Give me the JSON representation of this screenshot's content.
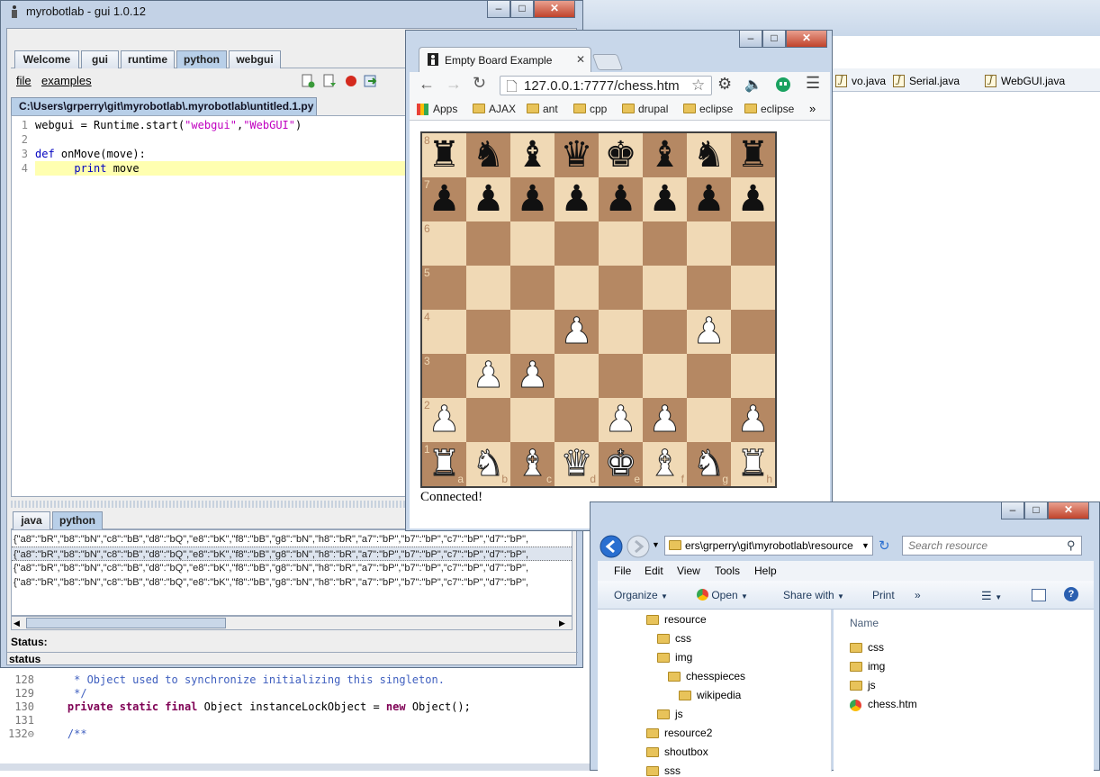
{
  "background": {
    "editor_tabs": [
      {
        "label": "vo.java"
      },
      {
        "label": "Serial.java"
      },
      {
        "label": "WebGUI.java"
      }
    ],
    "code_lines": [
      {
        "num": "128",
        "text": "     * Object used to synchronize initializing this singleton."
      },
      {
        "num": "129",
        "text": "     */"
      },
      {
        "num": "130",
        "kw": "private static final",
        "text": " Object instanceLockObject = ",
        "kw2": "new",
        "text2": " Object();"
      },
      {
        "num": "131",
        "text": ""
      },
      {
        "num": "132⊖",
        "text": "    /**"
      }
    ]
  },
  "mrl": {
    "title": "myrobotlab - gui 1.0.12",
    "tabs": [
      {
        "label": "Welcome"
      },
      {
        "label": "gui"
      },
      {
        "label": "runtime"
      },
      {
        "label": "python"
      },
      {
        "label": "webgui"
      }
    ],
    "menu": {
      "file": "file",
      "examples": "examples"
    },
    "file_tab": "C:\\Users\\grperry\\git\\myrobotlab\\.myrobotlab\\untitled.1.py",
    "code": [
      {
        "num": "1",
        "pre": "webgui = Runtime.start(",
        "s1": "\"webgui\"",
        "mid": ",",
        "s2": "\"WebGUI\"",
        "post": ")"
      },
      {
        "num": "2",
        "pre": "",
        "s1": "",
        "mid": "",
        "s2": "",
        "post": ""
      },
      {
        "num": "3",
        "kw": "def",
        "rest": " onMove(move):"
      },
      {
        "num": "4",
        "kw": "print",
        "rest": " move",
        "indent": "      "
      }
    ],
    "bottom_tabs": [
      {
        "label": "java"
      },
      {
        "label": "python"
      }
    ],
    "console_lines": [
      "{\"a8\":\"bR\",\"b8\":\"bN\",\"c8\":\"bB\",\"d8\":\"bQ\",\"e8\":\"bK\",\"f8\":\"bB\",\"g8\":\"bN\",\"h8\":\"bR\",\"a7\":\"bP\",\"b7\":\"bP\",\"c7\":\"bP\",\"d7\":\"bP\",",
      "{\"a8\":\"bR\",\"b8\":\"bN\",\"c8\":\"bB\",\"d8\":\"bQ\",\"e8\":\"bK\",\"f8\":\"bB\",\"g8\":\"bN\",\"h8\":\"bR\",\"a7\":\"bP\",\"b7\":\"bP\",\"c7\":\"bP\",\"d7\":\"bP\",",
      "{\"a8\":\"bR\",\"b8\":\"bN\",\"c8\":\"bB\",\"d8\":\"bQ\",\"e8\":\"bK\",\"f8\":\"bB\",\"g8\":\"bN\",\"h8\":\"bR\",\"a7\":\"bP\",\"b7\":\"bP\",\"c7\":\"bP\",\"d7\":\"bP\",",
      "{\"a8\":\"bR\",\"b8\":\"bN\",\"c8\":\"bB\",\"d8\":\"bQ\",\"e8\":\"bK\",\"f8\":\"bB\",\"g8\":\"bN\",\"h8\":\"bR\",\"a7\":\"bP\",\"b7\":\"bP\",\"c7\":\"bP\",\"d7\":\"bP\","
    ],
    "status_label": "Status:",
    "status_bar": "status"
  },
  "chrome": {
    "tab_title": "Empty Board Example",
    "url": "127.0.0.1:7777/chess.htm",
    "bookmarks": [
      {
        "label": "Apps"
      },
      {
        "label": "AJAX"
      },
      {
        "label": "ant"
      },
      {
        "label": "cpp"
      },
      {
        "label": "drupal"
      },
      {
        "label": "eclipse"
      },
      {
        "label": "eclipse"
      }
    ],
    "more": "»",
    "status_text": "Connected!"
  },
  "board": {
    "ranks": [
      "8",
      "7",
      "6",
      "5",
      "4",
      "3",
      "2",
      "1"
    ],
    "files": [
      "a",
      "b",
      "c",
      "d",
      "e",
      "f",
      "g",
      "h"
    ],
    "rows": [
      [
        "bR",
        "bN",
        "bB",
        "bQ",
        "bK",
        "bB",
        "bN",
        "bR"
      ],
      [
        "bP",
        "bP",
        "bP",
        "bP",
        "bP",
        "bP",
        "bP",
        "bP"
      ],
      [
        "",
        "",
        "",
        "",
        "",
        "",
        "",
        ""
      ],
      [
        "",
        "",
        "",
        "",
        "",
        "",
        "",
        ""
      ],
      [
        "",
        "",
        "",
        "wP",
        "",
        "",
        "wP",
        ""
      ],
      [
        "",
        "wP",
        "wP",
        "",
        "",
        "",
        "",
        ""
      ],
      [
        "wP",
        "",
        "",
        "",
        "wP",
        "wP",
        "",
        "wP"
      ],
      [
        "wR",
        "wN",
        "wB",
        "wQ",
        "wK",
        "wB",
        "wN",
        "wR"
      ]
    ]
  },
  "explorer": {
    "address": "ers\\grperry\\git\\myrobotlab\\resource",
    "search_placeholder": "Search resource",
    "menu": [
      "File",
      "Edit",
      "View",
      "Tools",
      "Help"
    ],
    "commands": [
      "Organize",
      "Open",
      "Share with",
      "Print"
    ],
    "more": "»",
    "tree": [
      {
        "label": "resource",
        "depth": 0
      },
      {
        "label": "css",
        "depth": 1
      },
      {
        "label": "img",
        "depth": 1
      },
      {
        "label": "chesspieces",
        "depth": 2
      },
      {
        "label": "wikipedia",
        "depth": 3
      },
      {
        "label": "js",
        "depth": 1
      },
      {
        "label": "resource2",
        "depth": 0
      },
      {
        "label": "shoutbox",
        "depth": 0
      },
      {
        "label": "sss",
        "depth": 0
      }
    ],
    "column_name": "Name",
    "files": [
      {
        "label": "css",
        "kind": "folder"
      },
      {
        "label": "img",
        "kind": "folder"
      },
      {
        "label": "js",
        "kind": "folder"
      },
      {
        "label": "chess.htm",
        "kind": "chrome"
      }
    ]
  }
}
